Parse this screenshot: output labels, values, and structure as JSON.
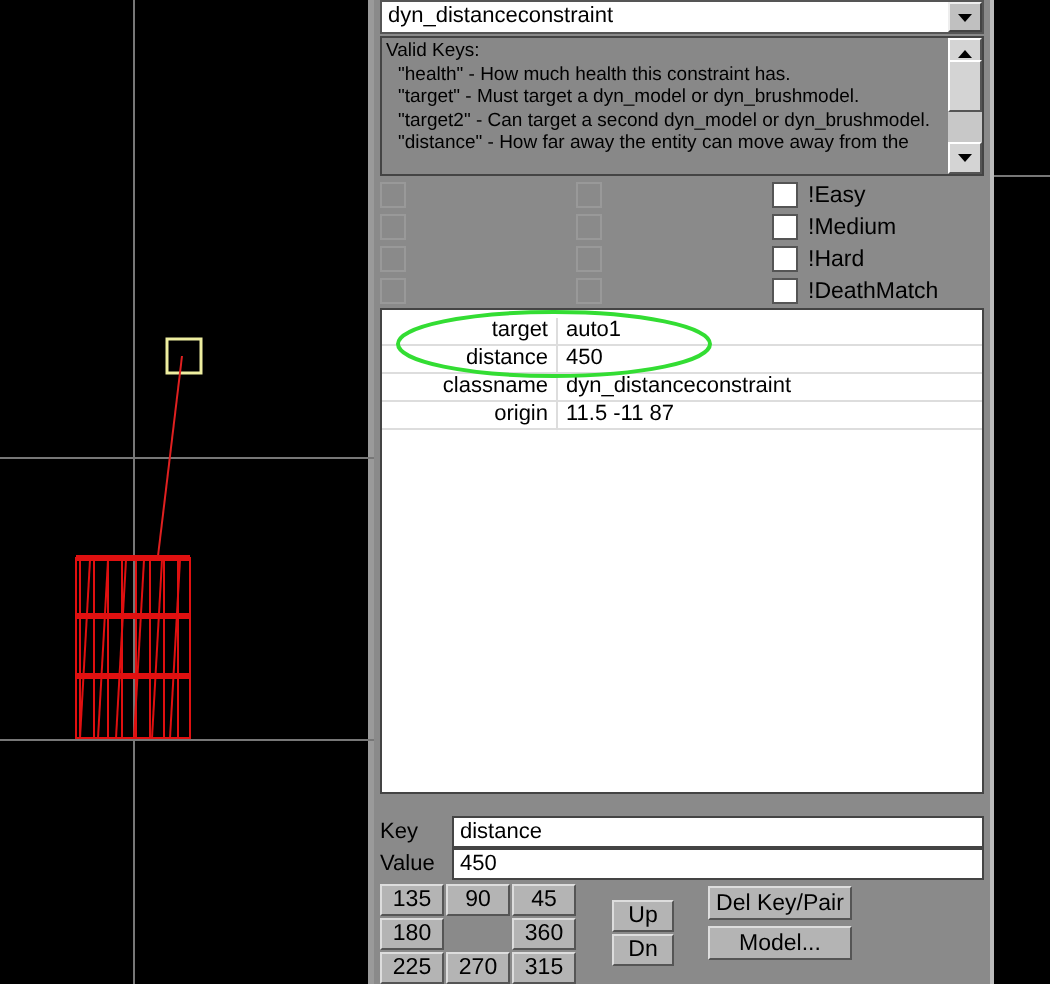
{
  "class_dropdown": {
    "value": "dyn_distanceconstraint"
  },
  "valid_keys": {
    "heading": "Valid Keys:",
    "lines": [
      "\"health\" - How much health this constraint has.",
      "\"target\" - Must target a dyn_model or dyn_brushmodel.",
      "\"target2\" - Can target a second dyn_model or dyn_brushmodel.",
      "\"distance\" - How far away the entity can move away from the"
    ]
  },
  "flag_columns": [
    [
      {
        "checked": false,
        "disabled": true
      },
      {
        "checked": false,
        "disabled": true
      },
      {
        "checked": false,
        "disabled": true
      },
      {
        "checked": false,
        "disabled": true
      }
    ],
    [
      {
        "checked": false,
        "disabled": true
      },
      {
        "checked": false,
        "disabled": true
      },
      {
        "checked": false,
        "disabled": true
      },
      {
        "checked": false,
        "disabled": true
      }
    ],
    [
      {
        "label": "!Easy",
        "checked": false,
        "disabled": false
      },
      {
        "label": "!Medium",
        "checked": false,
        "disabled": false
      },
      {
        "label": "!Hard",
        "checked": false,
        "disabled": false
      },
      {
        "label": "!DeathMatch",
        "checked": false,
        "disabled": false
      }
    ]
  ],
  "properties": [
    {
      "key": "target",
      "value": "auto1"
    },
    {
      "key": "distance",
      "value": "450"
    },
    {
      "key": "classname",
      "value": "dyn_distanceconstraint"
    },
    {
      "key": "origin",
      "value": "11.5 -11 87"
    }
  ],
  "key_field": {
    "label": "Key",
    "value": "distance"
  },
  "value_field": {
    "label": "Value",
    "value": "450"
  },
  "angle_buttons": [
    {
      "kind": "button",
      "label": "135"
    },
    {
      "kind": "button",
      "label": "90"
    },
    {
      "kind": "button",
      "label": "45"
    },
    {
      "kind": "button",
      "label": "180"
    },
    {
      "kind": "gap"
    },
    {
      "kind": "button",
      "label": "360"
    },
    {
      "kind": "button",
      "label": "225"
    },
    {
      "kind": "button",
      "label": "270"
    },
    {
      "kind": "button",
      "label": "315"
    }
  ],
  "move_buttons": [
    "Up",
    "Dn"
  ],
  "action_buttons": [
    "Del Key/Pair",
    "Model..."
  ]
}
